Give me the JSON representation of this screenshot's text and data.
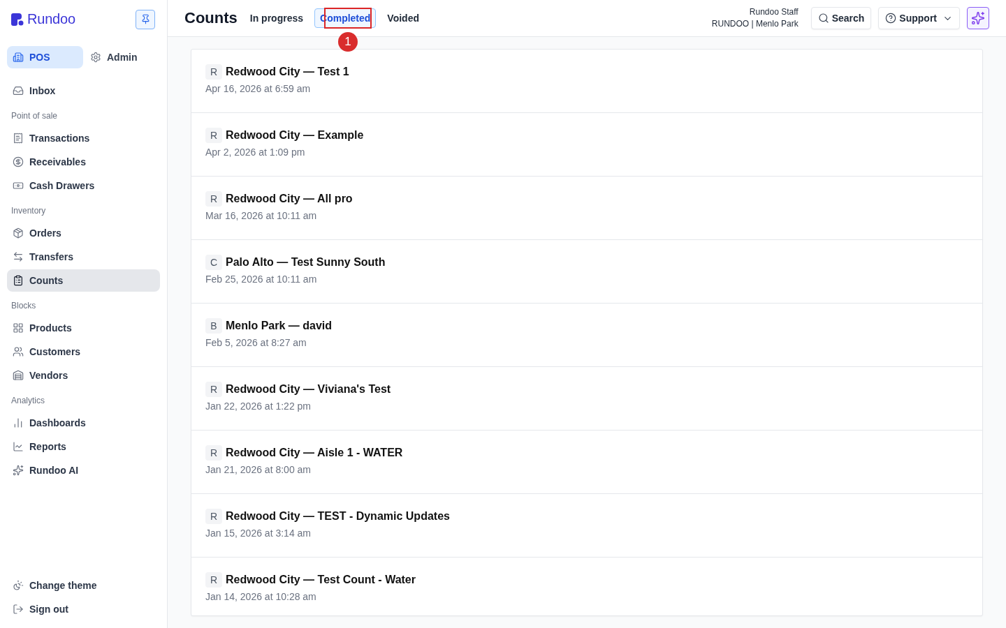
{
  "sidebar": {
    "brand": "Rundoo",
    "modes": [
      {
        "label": "POS",
        "selected": true
      },
      {
        "label": "Admin",
        "selected": false
      }
    ],
    "top_items": [
      {
        "label": "Inbox",
        "selected": false
      }
    ],
    "sections": [
      {
        "heading": "Point of sale",
        "items": [
          {
            "label": "Transactions",
            "selected": false
          },
          {
            "label": "Receivables",
            "selected": false
          },
          {
            "label": "Cash Drawers",
            "selected": false
          }
        ]
      },
      {
        "heading": "Inventory",
        "items": [
          {
            "label": "Orders",
            "selected": false
          },
          {
            "label": "Transfers",
            "selected": false
          },
          {
            "label": "Counts",
            "selected": true
          }
        ]
      },
      {
        "heading": "Blocks",
        "items": [
          {
            "label": "Products",
            "selected": false
          },
          {
            "label": "Customers",
            "selected": false
          },
          {
            "label": "Vendors",
            "selected": false
          }
        ]
      },
      {
        "heading": "Analytics",
        "items": [
          {
            "label": "Dashboards",
            "selected": false
          },
          {
            "label": "Reports",
            "selected": false
          },
          {
            "label": "Rundoo AI",
            "selected": false
          }
        ]
      }
    ],
    "footer_items": [
      {
        "label": "Change theme"
      },
      {
        "label": "Sign out"
      }
    ]
  },
  "header": {
    "title": "Counts",
    "tabs": [
      {
        "label": "In progress",
        "selected": false
      },
      {
        "label": "Completed",
        "selected": true
      },
      {
        "label": "Voided",
        "selected": false
      }
    ],
    "user": {
      "name": "Rundoo Staff",
      "store": "RUNDOO | Menlo Park"
    },
    "search_button": "Search",
    "support_button": "Support"
  },
  "annotation": {
    "label": "1"
  },
  "counts": [
    {
      "initial": "R",
      "title": "Redwood City — Test 1",
      "date": "Apr 16, 2026 at 6:59 am"
    },
    {
      "initial": "R",
      "title": "Redwood City — Example",
      "date": "Apr 2, 2026 at 1:09 pm"
    },
    {
      "initial": "R",
      "title": "Redwood City — All pro",
      "date": "Mar 16, 2026 at 10:11 am"
    },
    {
      "initial": "C",
      "title": "Palo Alto — Test Sunny South",
      "date": "Feb 25, 2026 at 10:11 am"
    },
    {
      "initial": "B",
      "title": "Menlo Park — david",
      "date": "Feb 5, 2026 at 8:27 am"
    },
    {
      "initial": "R",
      "title": "Redwood City — Viviana's Test",
      "date": "Jan 22, 2026 at 1:22 pm"
    },
    {
      "initial": "R",
      "title": "Redwood City — Aisle 1 - WATER",
      "date": "Jan 21, 2026 at 8:00 am"
    },
    {
      "initial": "R",
      "title": "Redwood City — TEST - Dynamic Updates",
      "date": "Jan 15, 2026 at 3:14 am"
    },
    {
      "initial": "R",
      "title": "Redwood City — Test Count - Water",
      "date": "Jan 14, 2026 at 10:28 am"
    }
  ]
}
